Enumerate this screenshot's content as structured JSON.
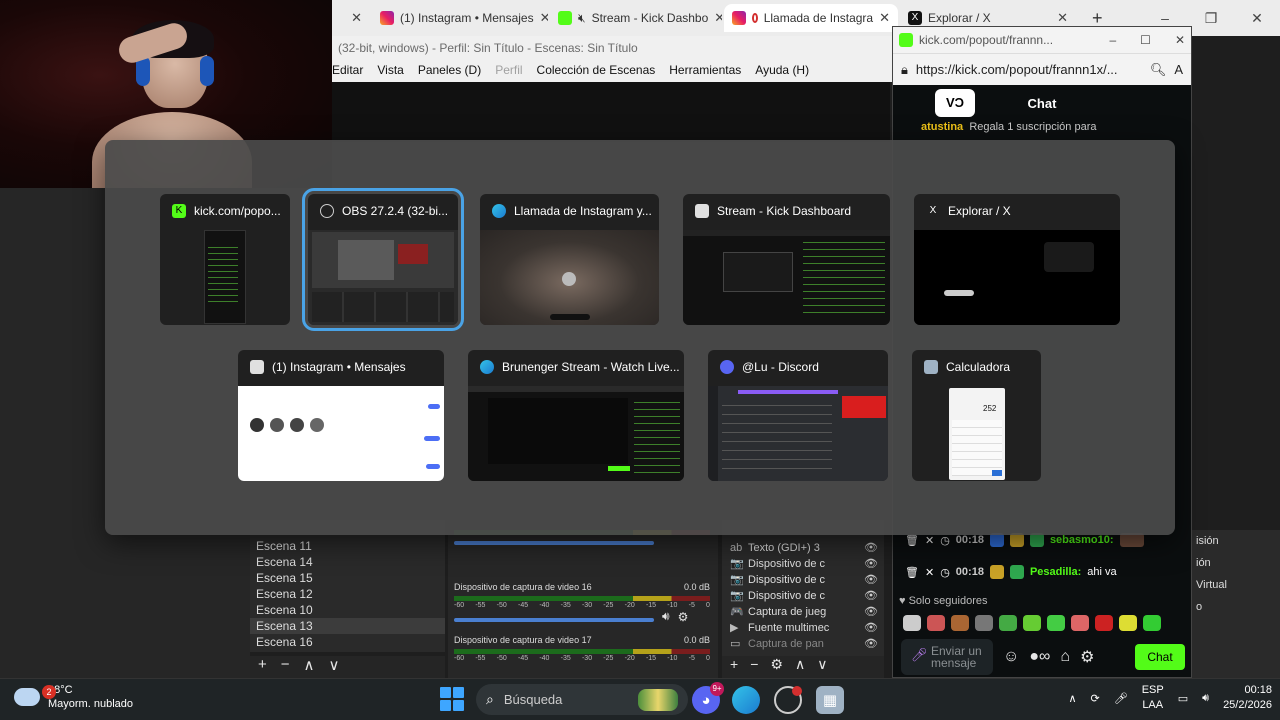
{
  "browser": {
    "tabs": [
      {
        "title": "(1) Instagram • Mensajes",
        "icon": "instagram-icon",
        "active": false
      },
      {
        "title": "Stream - Kick Dashbo",
        "icon": "kick-icon",
        "active": false
      },
      {
        "title": "Llamada de Instagra",
        "icon": "instagram-icon",
        "active": true
      },
      {
        "title": "Explorar / X",
        "icon": "x-icon",
        "active": false
      }
    ],
    "new_tab": "+",
    "window_controls": [
      "–",
      "❐",
      "✕"
    ]
  },
  "obs": {
    "title": "(32-bit, windows) - Perfil: Sin Título - Escenas: Sin Título",
    "menu": [
      "Editar",
      "Vista",
      "Paneles (D)",
      "Perfil",
      "Colección de Escenas",
      "Herramientas",
      "Ayuda (H)"
    ],
    "scenes": [
      "Escena 11",
      "Escena 14",
      "Escena 15",
      "Escena 12",
      "Escena 10",
      "Escena 13",
      "Escena 16"
    ],
    "selected_scene": "Escena 13",
    "scene_tools": [
      "+",
      "−",
      "∧",
      "∨"
    ],
    "mixer": [
      {
        "name": "Dispositivo de captura de video 16",
        "level": "0.0 dB",
        "ticks": [
          "-60",
          "-55",
          "-50",
          "-45",
          "-40",
          "-35",
          "-30",
          "-25",
          "-20",
          "-15",
          "-10",
          "-5",
          "0"
        ]
      },
      {
        "name": "Dispositivo de captura de video 17",
        "level": "0.0 dB",
        "ticks": [
          "-60",
          "-55",
          "-50",
          "-45",
          "-40",
          "-35",
          "-30",
          "-25",
          "-20",
          "-15",
          "-10",
          "-5",
          "0"
        ]
      }
    ],
    "sources": [
      {
        "name": "Texto (GDI+) 3",
        "icon": "ab"
      },
      {
        "name": "Dispositivo de c",
        "icon": "📷"
      },
      {
        "name": "Dispositivo de c",
        "icon": "📷"
      },
      {
        "name": "Dispositivo de c",
        "icon": "📷"
      },
      {
        "name": "Captura de jueg",
        "icon": "🎮"
      },
      {
        "name": "Fuente multimec",
        "icon": "▶"
      },
      {
        "name": "Captura de pan",
        "icon": "▭"
      }
    ],
    "source_tools": [
      "+",
      "−",
      "⚙",
      "∧",
      "∨"
    ]
  },
  "kick_popout": {
    "window_title": "kick.com/popout/frannn...",
    "url": "https://kick.com/popout/frannn1x/...",
    "header": "Chat",
    "logo": "VƆ",
    "sub_notice": {
      "user": "atustina",
      "text": "Regala 1 suscripción para"
    },
    "messages": [
      {
        "time": "00:18",
        "user": "sebasmo10:",
        "text": ""
      },
      {
        "time": "00:18",
        "user": "Pesadilla:",
        "text": "ahi va"
      }
    ],
    "followers_only": "Solo seguidores",
    "input_placeholder": "Enviar un mensaje",
    "send_label": "Chat"
  },
  "obs_right_panel": [
    "isión",
    "ión",
    "Virtual",
    "o"
  ],
  "alttab": {
    "row1": [
      {
        "title": "kick.com/popo...",
        "icon": "kick-icon",
        "color": "#53fc18"
      },
      {
        "title": "OBS 27.2.4 (32-bi...",
        "icon": "obs-icon",
        "color": "#cfcfcf",
        "selected": true
      },
      {
        "title": "Llamada de Instagram y...",
        "icon": "edge-icon",
        "color": "#2aa0d8"
      },
      {
        "title": "Stream - Kick Dashboard",
        "icon": "window-icon",
        "color": "#e0e0e0"
      },
      {
        "title": "Explorar / X",
        "icon": "x-icon",
        "color": "#ffffff"
      }
    ],
    "row2": [
      {
        "title": "(1) Instagram • Mensajes",
        "icon": "window-icon",
        "color": "#e0e0e0"
      },
      {
        "title": "Brunenger Stream - Watch Live...",
        "icon": "edge-icon",
        "color": "#2aa0d8"
      },
      {
        "title": "@Lu - Discord",
        "icon": "discord-icon",
        "color": "#5865f2"
      },
      {
        "title": "Calculadora",
        "icon": "calculator-icon",
        "color": "#9fb2c4"
      }
    ],
    "calculator_display": "252"
  },
  "taskbar": {
    "weather": {
      "temp": "28°C",
      "desc": "Mayorm. nublado",
      "badge": "2"
    },
    "search_placeholder": "Búsqueda",
    "discord_badge": "9+",
    "language": [
      "ESP",
      "LAA"
    ],
    "time": "00:18",
    "date": "25/2/2026"
  }
}
